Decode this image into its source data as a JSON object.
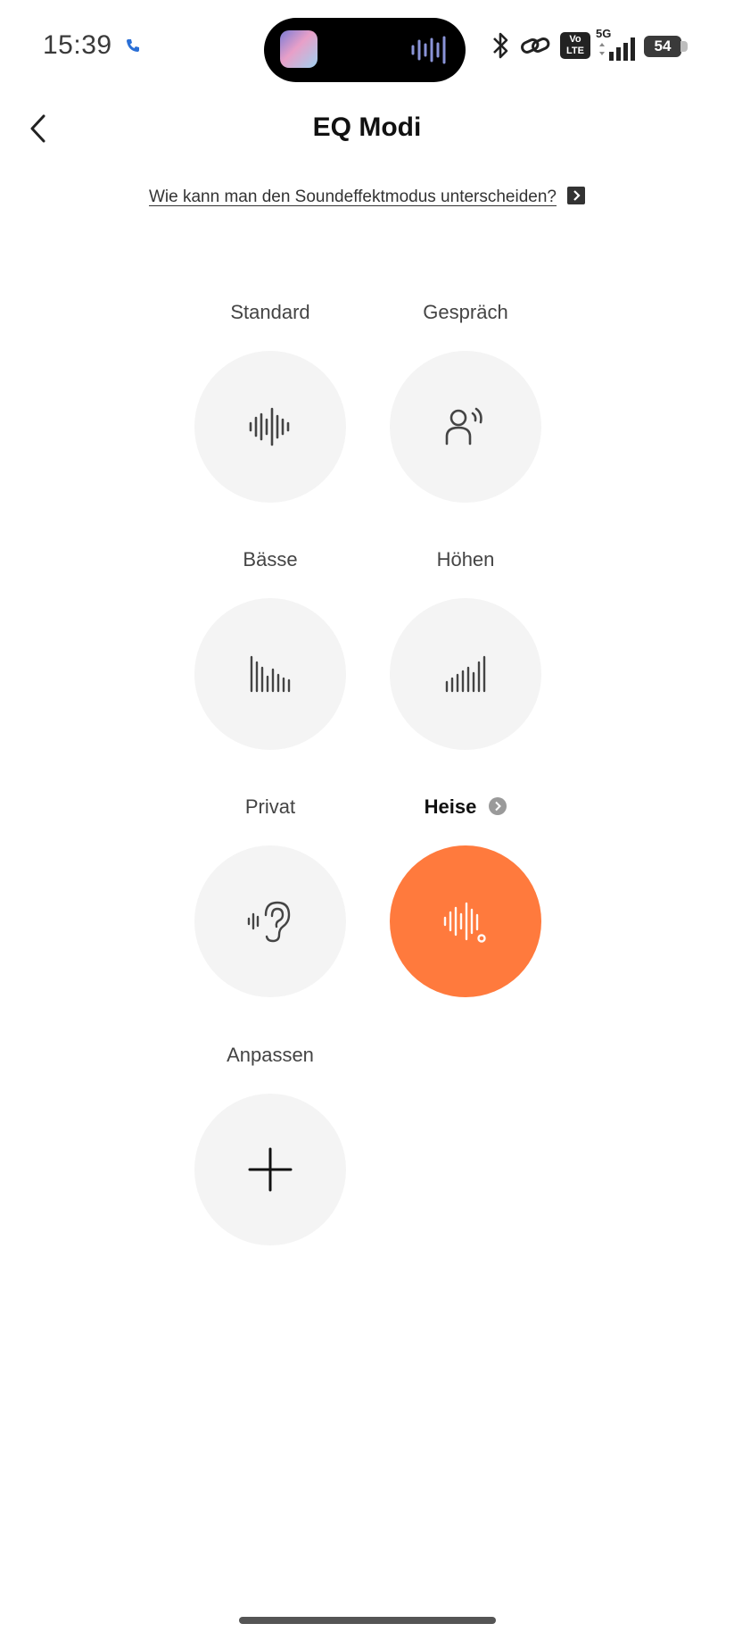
{
  "status_bar": {
    "time": "15:39",
    "volte_line1": "Vo",
    "volte_line2": "LTE",
    "network": "5G",
    "battery": "54",
    "icons": [
      "call-icon",
      "bluetooth-icon",
      "link-icon",
      "volte-icon",
      "signal-icon",
      "battery-icon"
    ]
  },
  "header": {
    "title": "EQ Modi",
    "back_icon": "chevron-left-icon"
  },
  "help_link": {
    "text": "Wie kann man den Soundeffektmodus unterscheiden?"
  },
  "modes": {
    "standard": {
      "label": "Standard",
      "icon": "waveform-icon"
    },
    "gespraech": {
      "label": "Gespräch",
      "icon": "person-speaking-icon"
    },
    "baesse": {
      "label": "Bässe",
      "icon": "bass-bars-icon"
    },
    "hoehen": {
      "label": "Höhen",
      "icon": "treble-bars-icon"
    },
    "privat": {
      "label": "Privat",
      "icon": "ear-icon"
    },
    "heise": {
      "label": "Heise",
      "icon": "custom-wave-icon",
      "selected": true
    },
    "anpassen": {
      "label": "Anpassen",
      "icon": "plus-icon"
    }
  },
  "colors": {
    "accent": "#ff7a3d",
    "circle_bg": "#f4f4f4"
  }
}
